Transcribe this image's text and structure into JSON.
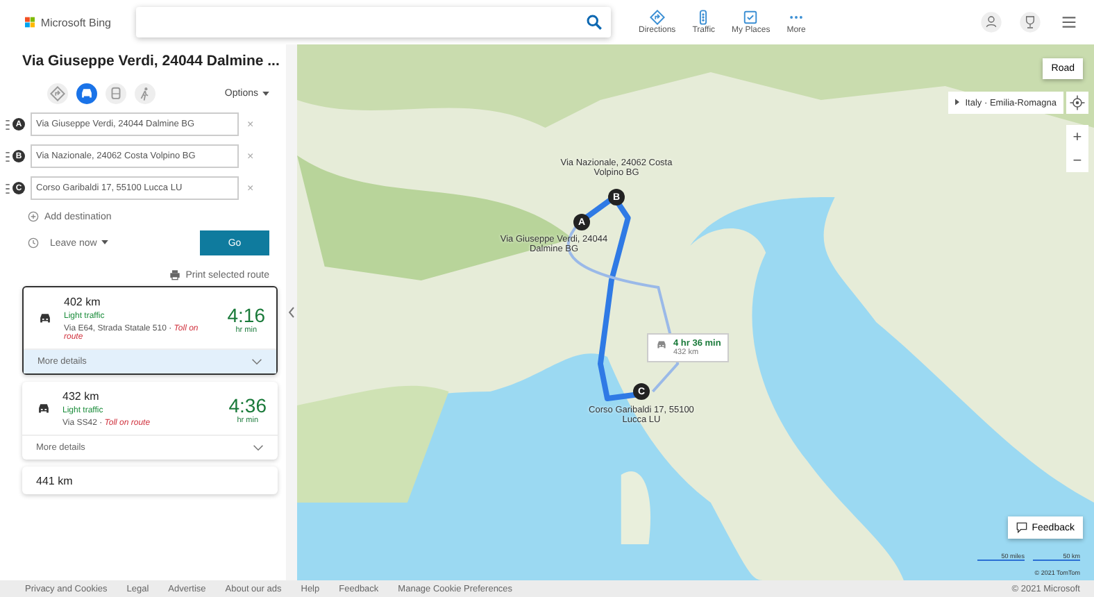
{
  "header": {
    "brand": "Microsoft Bing",
    "nav": [
      {
        "kind": "directions",
        "label": "Directions"
      },
      {
        "kind": "traffic",
        "label": "Traffic"
      },
      {
        "kind": "places",
        "label": "My Places"
      },
      {
        "kind": "more",
        "label": "More"
      }
    ]
  },
  "panel": {
    "title": "Via Giuseppe Verdi, 24044 Dalmine ...",
    "modes": [
      {
        "kind": "directions",
        "selected": false
      },
      {
        "kind": "car",
        "selected": true
      },
      {
        "kind": "transit",
        "selected": false
      },
      {
        "kind": "walk",
        "selected": false
      }
    ],
    "options": "Options",
    "waypoints": [
      {
        "letter": "A",
        "value": "Via Giuseppe Verdi, 24044 Dalmine BG",
        "remove": "×"
      },
      {
        "letter": "B",
        "value": "Via Nazionale, 24062 Costa Volpino BG",
        "remove": "×"
      },
      {
        "letter": "C",
        "value": "Corso Garibaldi 17, 55100 Lucca LU",
        "remove": "×"
      }
    ],
    "add_destination": "Add destination",
    "leave": "Leave now",
    "go": "Go",
    "print": "Print selected route",
    "routes": [
      {
        "distance": "402 km",
        "traffic": "Light traffic",
        "via": "Via E64, Strada Statale 510",
        "sep": "·",
        "toll": "Toll on route",
        "time": "4:16",
        "unit": "hr min",
        "more": "More details",
        "selected": true
      },
      {
        "distance": "432 km",
        "traffic": "Light traffic",
        "via": "Via SS42",
        "sep": "·",
        "toll": "Toll on route",
        "time": "4:36",
        "unit": "hr min",
        "more": "More details",
        "selected": false
      },
      {
        "distance": "441 km",
        "selected": false
      }
    ]
  },
  "map": {
    "style": "Road",
    "breadcrumb": "Italy · Emilia-Romagna",
    "zoom_in": "+",
    "zoom_out": "−",
    "pins": [
      {
        "letter": "B",
        "label": "Via Nazionale, 24062 Costa Volpino BG"
      },
      {
        "letter": "A",
        "label": "Via Giuseppe Verdi, 24044 Dalmine BG"
      },
      {
        "letter": "C",
        "label": "Corso Garibaldi 17, 55100 Lucca LU"
      }
    ],
    "callout": {
      "time": "4 hr 36 min",
      "distance": "432 km"
    },
    "feedback": "Feedback",
    "scale": [
      "50 miles",
      "50 km"
    ],
    "attribution": "© 2021 TomTom"
  },
  "footer": {
    "links": [
      "Privacy and Cookies",
      "Legal",
      "Advertise",
      "About our ads",
      "Help",
      "Feedback",
      "Manage Cookie Preferences"
    ],
    "copyright": "© 2021 Microsoft"
  }
}
